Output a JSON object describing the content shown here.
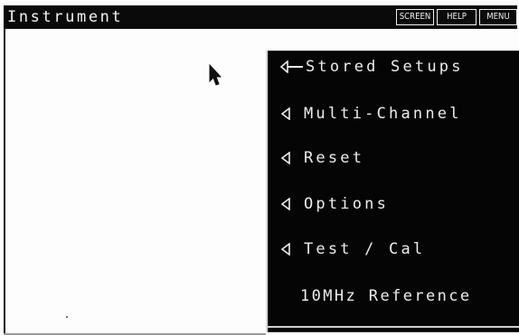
{
  "window": {
    "title": "Instrument"
  },
  "softkeys": {
    "screen_label": "SCREEN",
    "help_label": "HELP",
    "menu_label": "MENU"
  },
  "menu": {
    "items": [
      {
        "label": "Stored Setups",
        "icon": "submenu-arrow-icon"
      },
      {
        "label": "Multi-Channel",
        "icon": "submenu-arrow-icon"
      },
      {
        "label": "Reset",
        "icon": "submenu-arrow-icon"
      },
      {
        "label": "Options",
        "icon": "submenu-arrow-icon"
      },
      {
        "label": "Test / Cal",
        "icon": "submenu-arrow-icon"
      },
      {
        "label": "10MHz Reference"
      }
    ]
  },
  "colors": {
    "panel_background": "#050505",
    "panel_text": "#ededed",
    "screen_background": "#fdfdfd"
  }
}
